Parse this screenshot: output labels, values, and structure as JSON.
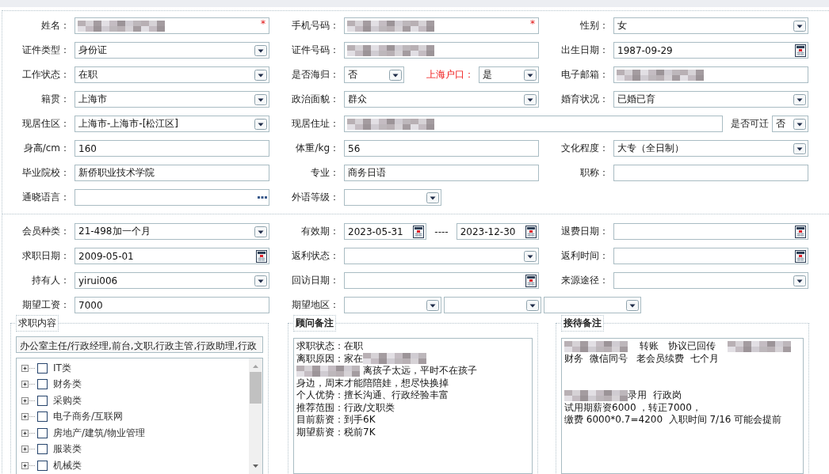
{
  "sections": [
    {
      "rows": [
        [
          {
            "label": "姓名：",
            "parts": [
              {
                "kind": "text",
                "redacted": true,
                "required_mark": "*"
              }
            ]
          },
          {
            "label": "手机号码：",
            "parts": [
              {
                "kind": "text",
                "redacted": true,
                "required_mark": "*"
              }
            ]
          },
          {
            "label": "性别：",
            "parts": [
              {
                "kind": "select",
                "value": "女"
              }
            ]
          }
        ],
        [
          {
            "label": "证件类型：",
            "parts": [
              {
                "kind": "select",
                "value": "身份证"
              }
            ]
          },
          {
            "label": "证件号码：",
            "parts": [
              {
                "kind": "text",
                "redacted": true
              }
            ]
          },
          {
            "label": "出生日期：",
            "parts": [
              {
                "kind": "date",
                "value": "1987-09-29"
              }
            ]
          }
        ],
        [
          {
            "label": "工作状态：",
            "parts": [
              {
                "kind": "select",
                "value": "在职"
              }
            ]
          },
          {
            "label": "是否海归：",
            "parts": [
              {
                "kind": "select",
                "value": "否"
              },
              {
                "kind": "label",
                "text": "上海户口：",
                "alert": true
              },
              {
                "kind": "select",
                "value": "是"
              }
            ]
          },
          {
            "label": "电子邮箱：",
            "parts": [
              {
                "kind": "text",
                "redacted": true
              }
            ]
          }
        ],
        [
          {
            "label": "籍贯：",
            "parts": [
              {
                "kind": "select",
                "value": "上海市"
              }
            ]
          },
          {
            "label": "政治面貌：",
            "parts": [
              {
                "kind": "select",
                "value": "群众"
              }
            ]
          },
          {
            "label": "婚育状况：",
            "parts": [
              {
                "kind": "select",
                "value": "已婚已育"
              }
            ]
          }
        ],
        [
          {
            "label": "现居住区：",
            "parts": [
              {
                "kind": "select",
                "value": " 上海市-上海市-[松江区]"
              }
            ]
          },
          {
            "label": "现居住址：",
            "parts": [
              {
                "kind": "text",
                "redacted": true
              },
              {
                "kind": "label",
                "text": "是否可迁"
              },
              {
                "kind": "select",
                "value": "否"
              }
            ]
          }
        ],
        [
          {
            "label": "身高/cm：",
            "parts": [
              {
                "kind": "text",
                "value": "160"
              }
            ]
          },
          {
            "label": "体重/kg：",
            "parts": [
              {
                "kind": "text",
                "value": "56"
              }
            ]
          },
          {
            "label": "文化程度：",
            "parts": [
              {
                "kind": "select",
                "value": "大专（全日制）"
              }
            ]
          }
        ],
        [
          {
            "label": "毕业院校：",
            "parts": [
              {
                "kind": "text",
                "value": "新侨职业技术学院"
              }
            ]
          },
          {
            "label": "专业：",
            "parts": [
              {
                "kind": "text",
                "value": "商务日语"
              }
            ]
          },
          {
            "label": "职称：",
            "parts": [
              {
                "kind": "text"
              }
            ]
          }
        ],
        [
          {
            "label": "通晓语言：",
            "parts": [
              {
                "kind": "lookup"
              }
            ]
          },
          {
            "label": "外语等级：",
            "parts": [
              {
                "kind": "select"
              }
            ]
          }
        ]
      ]
    },
    {
      "rows": [
        [
          {
            "label": "会员种类：",
            "parts": [
              {
                "kind": "select",
                "value": " 21-498加一个月"
              }
            ]
          },
          {
            "label": "有效期：",
            "parts": [
              {
                "kind": "date",
                "value": "2023-05-31"
              },
              {
                "kind": "sep",
                "text": "----"
              },
              {
                "kind": "date",
                "value": "2023-12-30"
              }
            ]
          },
          {
            "label": "退费日期：",
            "parts": [
              {
                "kind": "date"
              }
            ]
          }
        ],
        [
          {
            "label": "求职日期：",
            "parts": [
              {
                "kind": "date",
                "value": "2009-05-01"
              }
            ]
          },
          {
            "label": "返利状态：",
            "parts": [
              {
                "kind": "select"
              }
            ]
          },
          {
            "label": "返利时间：",
            "parts": [
              {
                "kind": "date"
              }
            ]
          }
        ],
        [
          {
            "label": "持有人：",
            "parts": [
              {
                "kind": "select",
                "value": "yirui006"
              }
            ]
          },
          {
            "label": "回访日期：",
            "parts": [
              {
                "kind": "date"
              }
            ]
          },
          {
            "label": "来源途径：",
            "parts": [
              {
                "kind": "select"
              }
            ]
          }
        ],
        [
          {
            "label": "期望工资：",
            "parts": [
              {
                "kind": "text",
                "value": "7000"
              }
            ]
          },
          {
            "label": "期望地区：",
            "parts": [
              {
                "kind": "select"
              },
              {
                "kind": "select"
              },
              {
                "kind": "select"
              }
            ]
          }
        ]
      ]
    }
  ],
  "panels": [
    {
      "kind": "tree",
      "title": "求职内容",
      "summary": "办公室主任/行政经理,前台,文职,行政主管,行政助理,行政",
      "items": [
        {
          "label": "IT类",
          "expanded": false,
          "checked": false
        },
        {
          "label": "财务类",
          "expanded": false,
          "checked": false
        },
        {
          "label": "采购类",
          "expanded": false,
          "checked": false
        },
        {
          "label": "电子商务/互联网",
          "expanded": false,
          "checked": false
        },
        {
          "label": "房地产/建筑/物业管理",
          "expanded": false,
          "checked": false
        },
        {
          "label": "服装类",
          "expanded": false,
          "checked": false
        },
        {
          "label": "机械类",
          "expanded": false,
          "checked": false
        }
      ]
    },
    {
      "kind": "notes",
      "title": "顾问备注",
      "lines": [
        {
          "segments": [
            {
              "kind": "text",
              "text": "求职状态：在职"
            }
          ]
        },
        {
          "segments": [
            {
              "kind": "text",
              "text": "离职原因：家在"
            },
            {
              "kind": "redacted"
            }
          ]
        },
        {
          "segments": [
            {
              "kind": "redacted"
            },
            {
              "kind": "text",
              "text": " 离孩子太远，平时不在孩子"
            }
          ]
        },
        {
          "segments": [
            {
              "kind": "text",
              "text": "身边，周末才能陪陪娃，想尽快换掉"
            }
          ]
        },
        {
          "segments": [
            {
              "kind": "text",
              "text": "个人优势：擅长沟通、行政经验丰富"
            }
          ]
        },
        {
          "segments": [
            {
              "kind": "text",
              "text": "推荐范围：行政/文职类"
            }
          ]
        },
        {
          "segments": [
            {
              "kind": "text",
              "text": "目前薪资：到手6K"
            }
          ]
        },
        {
          "segments": [
            {
              "kind": "text",
              "text": "期望薪资：税前7K"
            }
          ]
        }
      ]
    },
    {
      "kind": "notes",
      "title": "接待备注",
      "lines": [
        {
          "segments": [
            {
              "kind": "redacted"
            },
            {
              "kind": "text",
              "text": "    转账   协议已回传    "
            },
            {
              "kind": "redacted"
            }
          ]
        },
        {
          "segments": [
            {
              "kind": "text",
              "text": "财务  微信同号   老会员续费  七个月"
            }
          ]
        },
        {
          "kind": "blank"
        },
        {
          "kind": "blank"
        },
        {
          "segments": [
            {
              "kind": "redacted"
            },
            {
              "kind": "text",
              "text": "录用  行政岗"
            }
          ]
        },
        {
          "segments": [
            {
              "kind": "text",
              "text": "试用期薪资6000 ，转正7000，"
            }
          ]
        },
        {
          "segments": [
            {
              "kind": "text",
              "text": "缴费 6000*0.7=4200  入职时间 7/16 可能会提前"
            }
          ]
        }
      ]
    }
  ]
}
